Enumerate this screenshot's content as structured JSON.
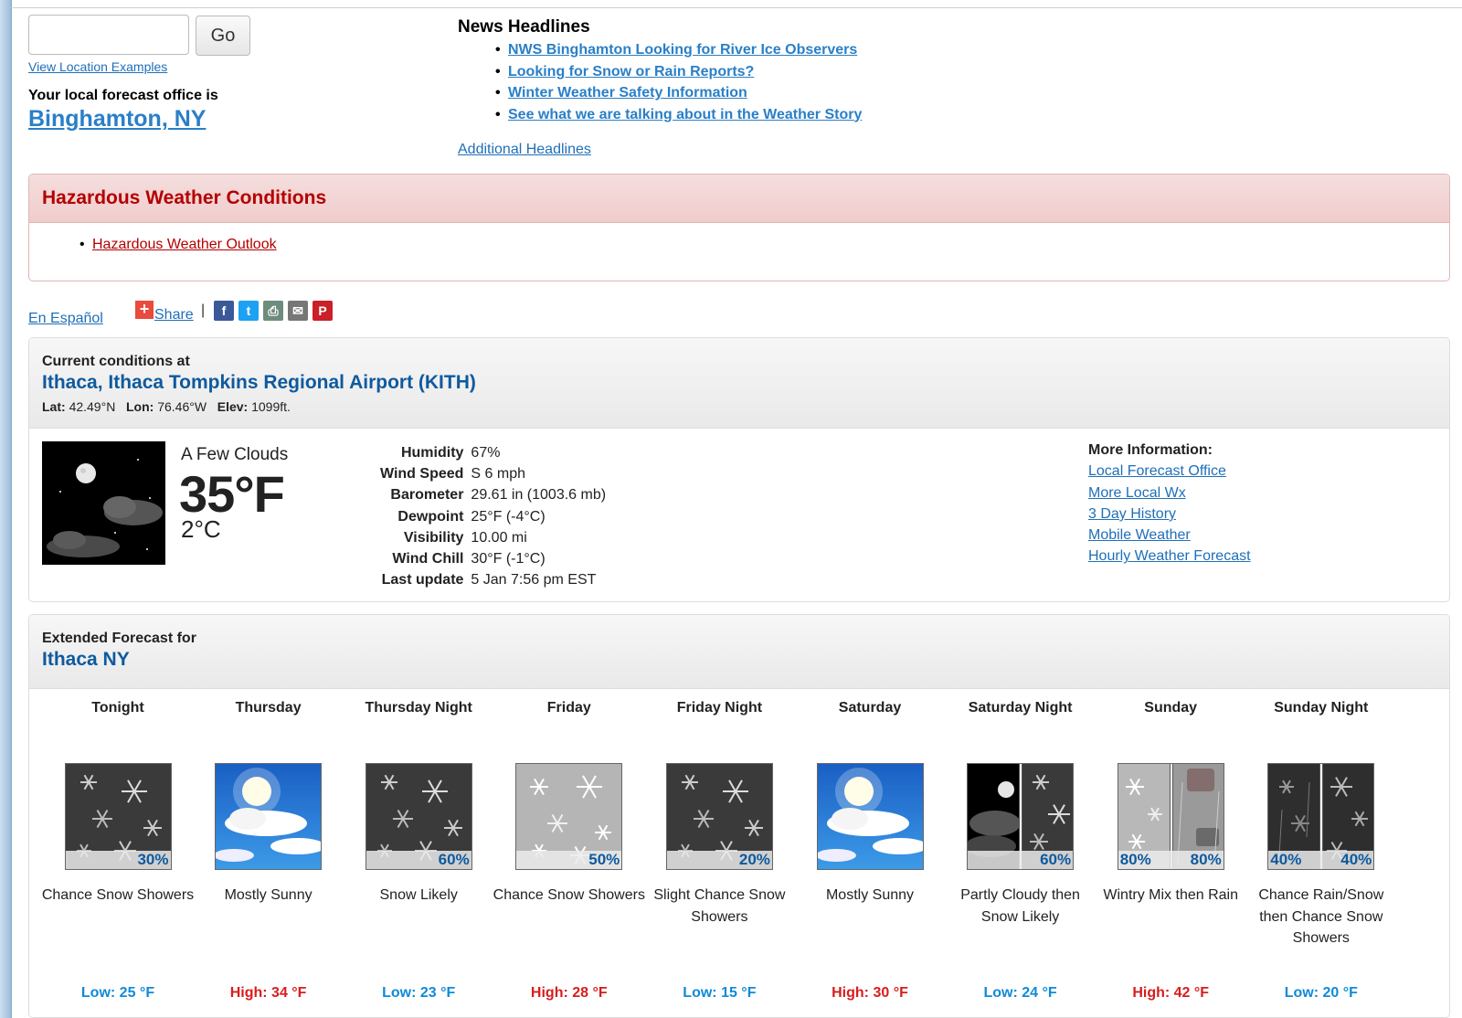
{
  "search": {
    "value": "",
    "go_label": "Go",
    "examples_link": "View Location Examples"
  },
  "office": {
    "label": "Your local forecast office is",
    "name": "Binghamton, NY"
  },
  "news": {
    "title": "News Headlines",
    "items": [
      "NWS Binghamton Looking for River Ice Observers",
      "Looking for Snow or Rain Reports?",
      "Winter Weather Safety Information",
      "See what we are talking about in the Weather Story"
    ],
    "more": "Additional Headlines"
  },
  "hazard": {
    "title": "Hazardous Weather Conditions",
    "item": "Hazardous Weather Outlook",
    "colors": {
      "text": "#b40000"
    }
  },
  "share": {
    "espanol": "En Español",
    "share_label": "Share",
    "separator": "|",
    "buttons": [
      {
        "icon": "facebook-icon",
        "glyph": "f",
        "color": "#3b5998"
      },
      {
        "icon": "twitter-icon",
        "glyph": "t",
        "color": "#1da1f2"
      },
      {
        "icon": "print-icon",
        "glyph": "⎙",
        "color": "#6e8c7e"
      },
      {
        "icon": "email-icon",
        "glyph": "✉",
        "color": "#777777"
      },
      {
        "icon": "pinterest-icon",
        "glyph": "P",
        "color": "#cb2027"
      }
    ]
  },
  "current": {
    "label": "Current conditions at",
    "station": "Ithaca, Ithaca Tompkins Regional Airport (KITH)",
    "lat_label": "Lat:",
    "lat": "42.49°N",
    "lon_label": "Lon:",
    "lon": "76.46°W",
    "elev_label": "Elev:",
    "elev": "1099ft.",
    "condition": "A Few Clouds",
    "temp_f": "35°F",
    "temp_c": "2°C",
    "details": [
      {
        "label": "Humidity",
        "value": "67%"
      },
      {
        "label": "Wind Speed",
        "value": "S 6 mph"
      },
      {
        "label": "Barometer",
        "value": "29.61 in (1003.6 mb)"
      },
      {
        "label": "Dewpoint",
        "value": "25°F (-4°C)"
      },
      {
        "label": "Visibility",
        "value": "10.00 mi"
      },
      {
        "label": "Wind Chill",
        "value": "30°F (-1°C)"
      },
      {
        "label": "Last update",
        "value": "5 Jan 7:56 pm EST"
      }
    ],
    "more_info": {
      "title": "More Information:",
      "links": [
        "Local Forecast Office",
        "More Local Wx",
        "3 Day History",
        "Mobile Weather",
        "Hourly Weather Forecast"
      ]
    }
  },
  "extended": {
    "label": "Extended Forecast for",
    "location": "Ithaca NY",
    "periods": [
      {
        "name": "Tonight",
        "icon": "snow-night",
        "pop": "30%",
        "desc": "Chance Snow Showers",
        "temp": "Low: 25 °F",
        "kind": "low"
      },
      {
        "name": "Thursday",
        "icon": "sunny",
        "pop": "",
        "desc": "Mostly Sunny",
        "temp": "High: 34 °F",
        "kind": "high"
      },
      {
        "name": "Thursday Night",
        "icon": "snow-night",
        "pop": "60%",
        "desc": "Snow Likely",
        "temp": "Low: 23 °F",
        "kind": "low"
      },
      {
        "name": "Friday",
        "icon": "snow-day",
        "pop": "50%",
        "desc": "Chance Snow Showers",
        "temp": "High: 28 °F",
        "kind": "high"
      },
      {
        "name": "Friday Night",
        "icon": "snow-night",
        "pop": "20%",
        "desc": "Slight Chance Snow Showers",
        "temp": "Low: 15 °F",
        "kind": "low"
      },
      {
        "name": "Saturday",
        "icon": "sunny",
        "pop": "",
        "desc": "Mostly Sunny",
        "temp": "High: 30 °F",
        "kind": "high"
      },
      {
        "name": "Saturday Night",
        "icon": "cloudy-night-snow",
        "pop": "60%",
        "desc": "Partly Cloudy then Snow Likely",
        "temp": "Low: 24 °F",
        "kind": "low"
      },
      {
        "name": "Sunday",
        "icon": "wintry-rain",
        "pop_left": "80%",
        "pop": "80%",
        "desc": "Wintry Mix then Rain",
        "temp": "High: 42 °F",
        "kind": "high"
      },
      {
        "name": "Sunday Night",
        "icon": "rain-snow-night",
        "pop_left": "40%",
        "pop": "40%",
        "desc": "Chance Rain/Snow then Chance Snow Showers",
        "temp": "Low: 20 °F",
        "kind": "low"
      }
    ],
    "colors": {
      "low": "#0f8ad8",
      "high": "#d91c1c"
    }
  }
}
